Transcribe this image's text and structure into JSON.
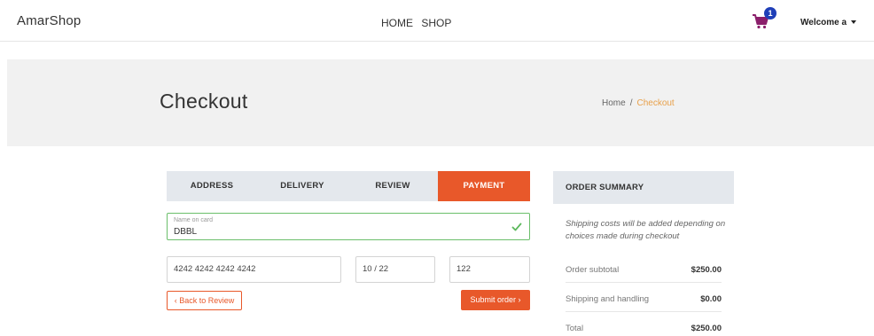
{
  "nav": {
    "brand": "AmarShop",
    "links": [
      "HOME",
      "SHOP"
    ],
    "cart_count": "1",
    "welcome": "Welcome a"
  },
  "banner": {
    "title": "Checkout",
    "breadcrumb": [
      "Home",
      "Checkout"
    ]
  },
  "steps": [
    "ADDRESS",
    "DELIVERY",
    "REVIEW",
    "PAYMENT"
  ],
  "active_step": "PAYMENT",
  "payment": {
    "name_label": "Name on card",
    "name_value": "DBBL",
    "card_number": "4242 4242 4242 4242",
    "expiry": "10 / 22",
    "cvc": "122",
    "back_label": "‹ Back to Review",
    "submit_label": "Submit order ›"
  },
  "summary": {
    "title": "ORDER SUMMARY",
    "note": "Shipping costs will be added depending on choices made during checkout",
    "rows": [
      {
        "label": "Order subtotal",
        "value": "$250.00"
      },
      {
        "label": "Shipping and handling",
        "value": "$0.00"
      },
      {
        "label": "Total",
        "value": "$250.00"
      }
    ]
  },
  "colors": {
    "accent": "#e8582a",
    "badge": "#1f3fb8",
    "cart_icon": "#8b1f6b",
    "success": "#5cb85c",
    "breadcrumb_current": "#e8a04a"
  },
  "icons": [
    "cart-icon",
    "check-icon",
    "caret-down-icon"
  ]
}
